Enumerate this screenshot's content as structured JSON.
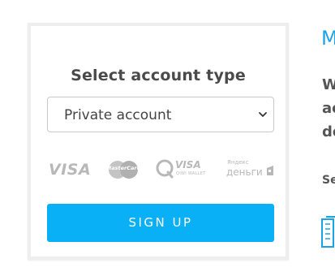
{
  "form": {
    "title": "Select account type",
    "account_type": {
      "selected": "Private account"
    },
    "payment_logos": {
      "visa": "VISA",
      "mastercard": "MasterCard",
      "qiwi_visa": "VISA",
      "qiwi_wallet": "QIWI WALLET",
      "yandex_top": "Яндекс",
      "yandex_bottom": "деньги"
    },
    "submit_label": "SIGN UP"
  },
  "side_panel": {
    "heading": "M",
    "lines": [
      "W",
      "ac",
      "de"
    ],
    "sub": "Se"
  },
  "colors": {
    "accent": "#0ab0f5",
    "heading_blue": "#1aa3e8",
    "text_dark": "#4a4a4a",
    "logo_grey": "#b8b8b8"
  }
}
